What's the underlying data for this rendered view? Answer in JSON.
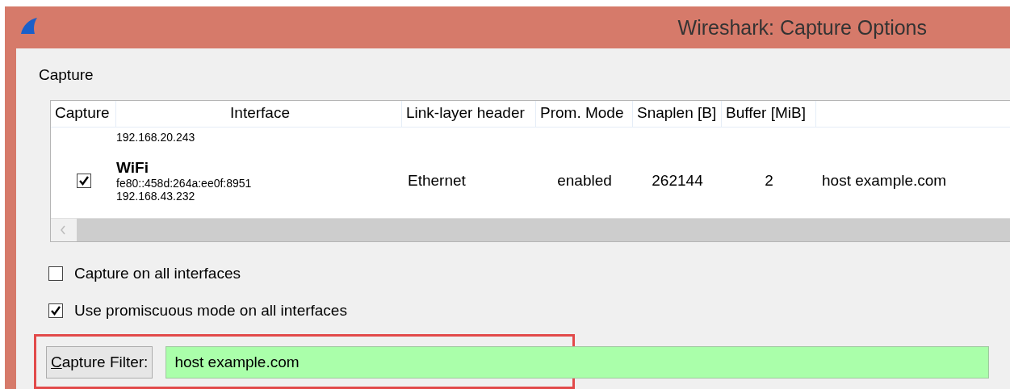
{
  "window": {
    "title": "Wireshark: Capture Options"
  },
  "section": {
    "label": "Capture"
  },
  "table": {
    "columns": [
      "Capture",
      "Interface",
      "Link-layer header",
      "Prom. Mode",
      "Snaplen [B]",
      "Buffer [MiB]"
    ],
    "rows": [
      {
        "kind": "partial",
        "addresses": [
          "192.168.20.243"
        ]
      },
      {
        "kind": "full",
        "checked": true,
        "name": "WiFi",
        "addresses": [
          "fe80::458d:264a:ee0f:8951",
          "192.168.43.232"
        ],
        "link": "Ethernet",
        "prom": "enabled",
        "snaplen": "262144",
        "buffer": "2",
        "filter": "host example.com"
      }
    ]
  },
  "options": [
    {
      "label": "Capture on all interfaces",
      "checked": false
    },
    {
      "label": "Use promiscuous mode on all interfaces",
      "checked": true
    }
  ],
  "filter": {
    "button": "Capture Filter:",
    "value": "host example.com",
    "highlighted": true
  }
}
